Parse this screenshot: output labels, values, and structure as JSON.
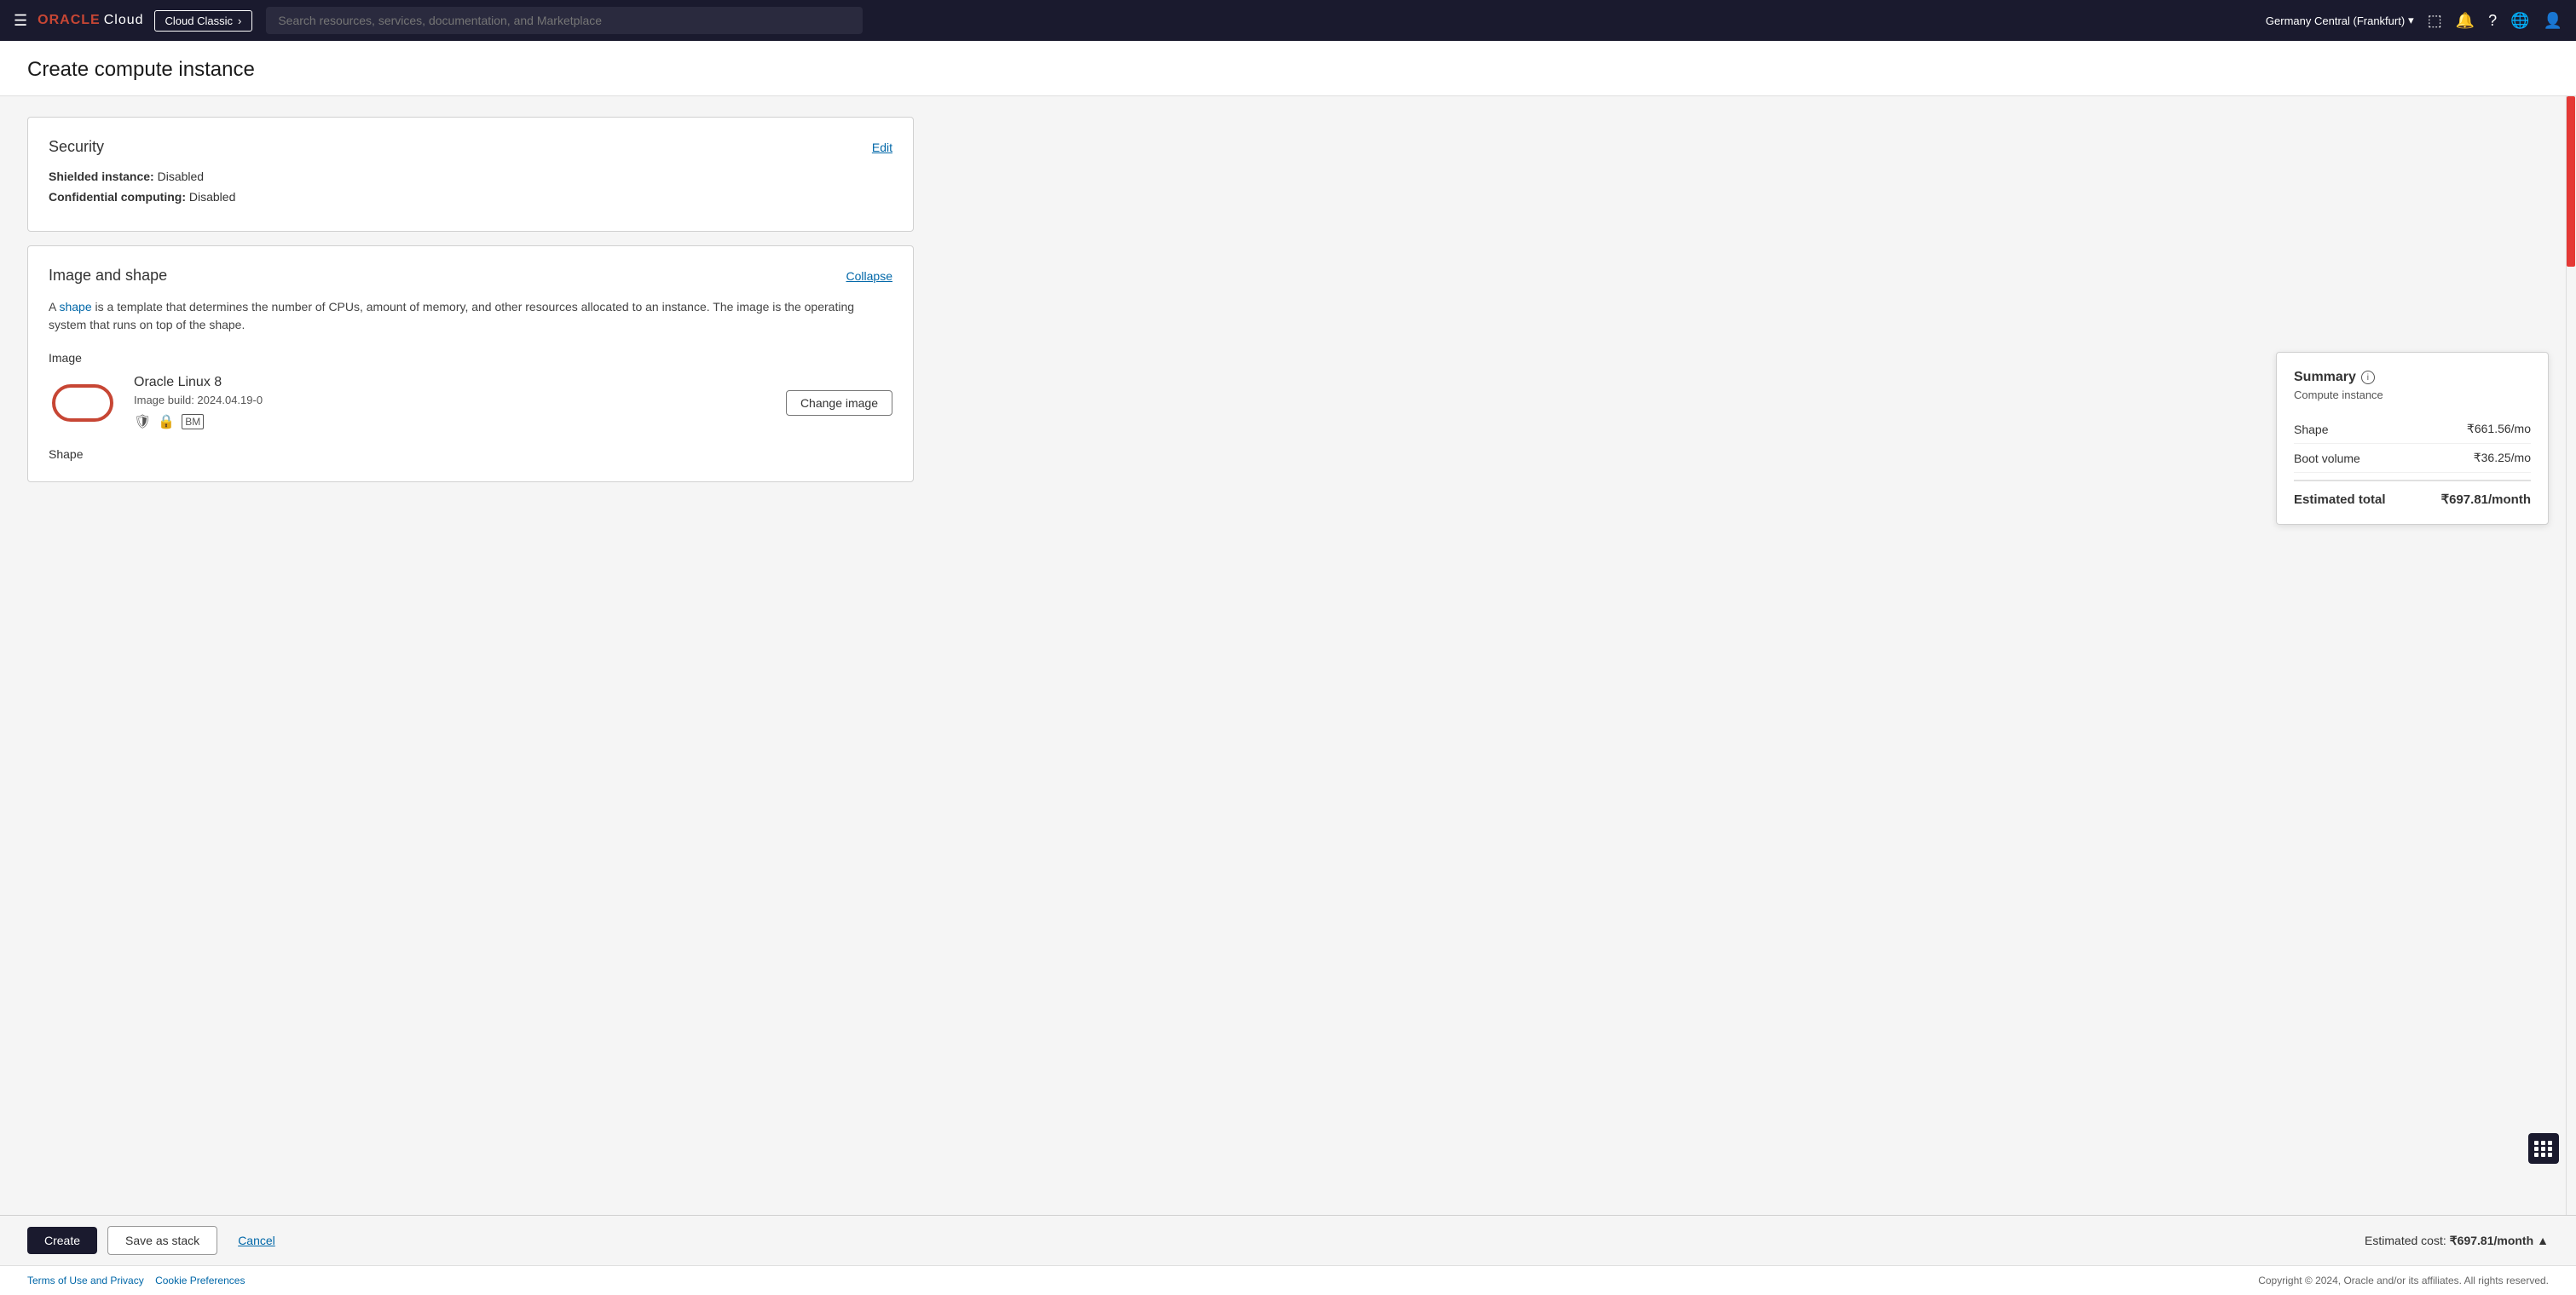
{
  "nav": {
    "hamburger": "☰",
    "logo_oracle": "ORACLE",
    "logo_cloud": "Cloud",
    "classic_btn": "Cloud Classic",
    "classic_arrow": "›",
    "search_placeholder": "Search resources, services, documentation, and Marketplace",
    "region": "Germany Central (Frankfurt)",
    "region_arrow": "▾"
  },
  "page": {
    "title": "Create compute instance"
  },
  "security_card": {
    "title": "Security",
    "edit_link": "Edit",
    "shielded_label": "Shielded instance:",
    "shielded_value": "Disabled",
    "confidential_label": "Confidential computing:",
    "confidential_value": "Disabled"
  },
  "image_shape_card": {
    "title": "Image and shape",
    "collapse_link": "Collapse",
    "description": "A shape is a template that determines the number of CPUs, amount of memory, and other resources allocated to an instance. The image is the operating system that runs on top of the shape.",
    "shape_link_text": "shape",
    "image_section_label": "Image",
    "image_name": "Oracle Linux 8",
    "image_build": "Image build: 2024.04.19-0",
    "change_image_btn": "Change image",
    "shape_section_label": "Shape"
  },
  "summary": {
    "title": "Summary",
    "info_icon": "i",
    "subtitle": "Compute instance",
    "shape_label": "Shape",
    "shape_cost": "₹661.56/mo",
    "boot_volume_label": "Boot volume",
    "boot_volume_cost": "₹36.25/mo",
    "total_label": "Estimated total",
    "total_cost": "₹697.81/month"
  },
  "bottom_bar": {
    "create_btn": "Create",
    "save_stack_btn": "Save as stack",
    "cancel_btn": "Cancel",
    "estimated_cost_prefix": "Estimated cost:",
    "estimated_cost": "₹697.81/month",
    "chevron_up": "▲"
  },
  "footer": {
    "terms_link": "Terms of Use and Privacy",
    "cookie_link": "Cookie Preferences",
    "copyright": "Copyright © 2024, Oracle and/or its affiliates. All rights reserved."
  }
}
